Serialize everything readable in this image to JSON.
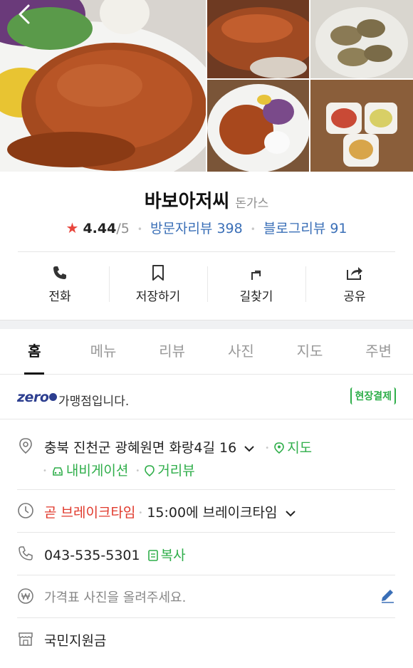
{
  "header": {
    "back_icon": "chevron-left-icon",
    "profile_icon": "user-avatar-icon"
  },
  "place": {
    "name": "바보아저씨",
    "category": "돈가스",
    "rating_star": "★",
    "rating": "4.44",
    "rating_max": "/5",
    "visitor_reviews": "방문자리뷰 398",
    "blog_reviews": "블로그리뷰 91"
  },
  "actions": [
    {
      "label": "전화",
      "icon": "phone-icon"
    },
    {
      "label": "저장하기",
      "icon": "bookmark-icon"
    },
    {
      "label": "길찾기",
      "icon": "directions-icon"
    },
    {
      "label": "공유",
      "icon": "share-icon"
    }
  ],
  "tabs": [
    "홈",
    "메뉴",
    "리뷰",
    "사진",
    "지도",
    "주변"
  ],
  "active_tab": "홈",
  "zeropay": {
    "logo": "zero",
    "text": "가맹점입니다.",
    "badge": "현장결제"
  },
  "address": {
    "text": "충북 진천군 광혜원면 화랑4길 16",
    "map_link": "지도",
    "navigation_link": "내비게이션",
    "street_view_link": "거리뷰"
  },
  "hours": {
    "status": "곧 브레이크타임",
    "detail": "15:00에 브레이크타임"
  },
  "phone": {
    "number": "043-535-5301",
    "copy_label": "복사"
  },
  "price": {
    "prompt": "가격표 사진을 올려주세요."
  },
  "subsidy": {
    "text": "국민지원금"
  },
  "colors": {
    "link_blue": "#3a6fb7",
    "green": "#2fae4a",
    "red": "#e0392c",
    "star_red": "#e8453c",
    "zeropay_navy": "#2c3e8f"
  }
}
